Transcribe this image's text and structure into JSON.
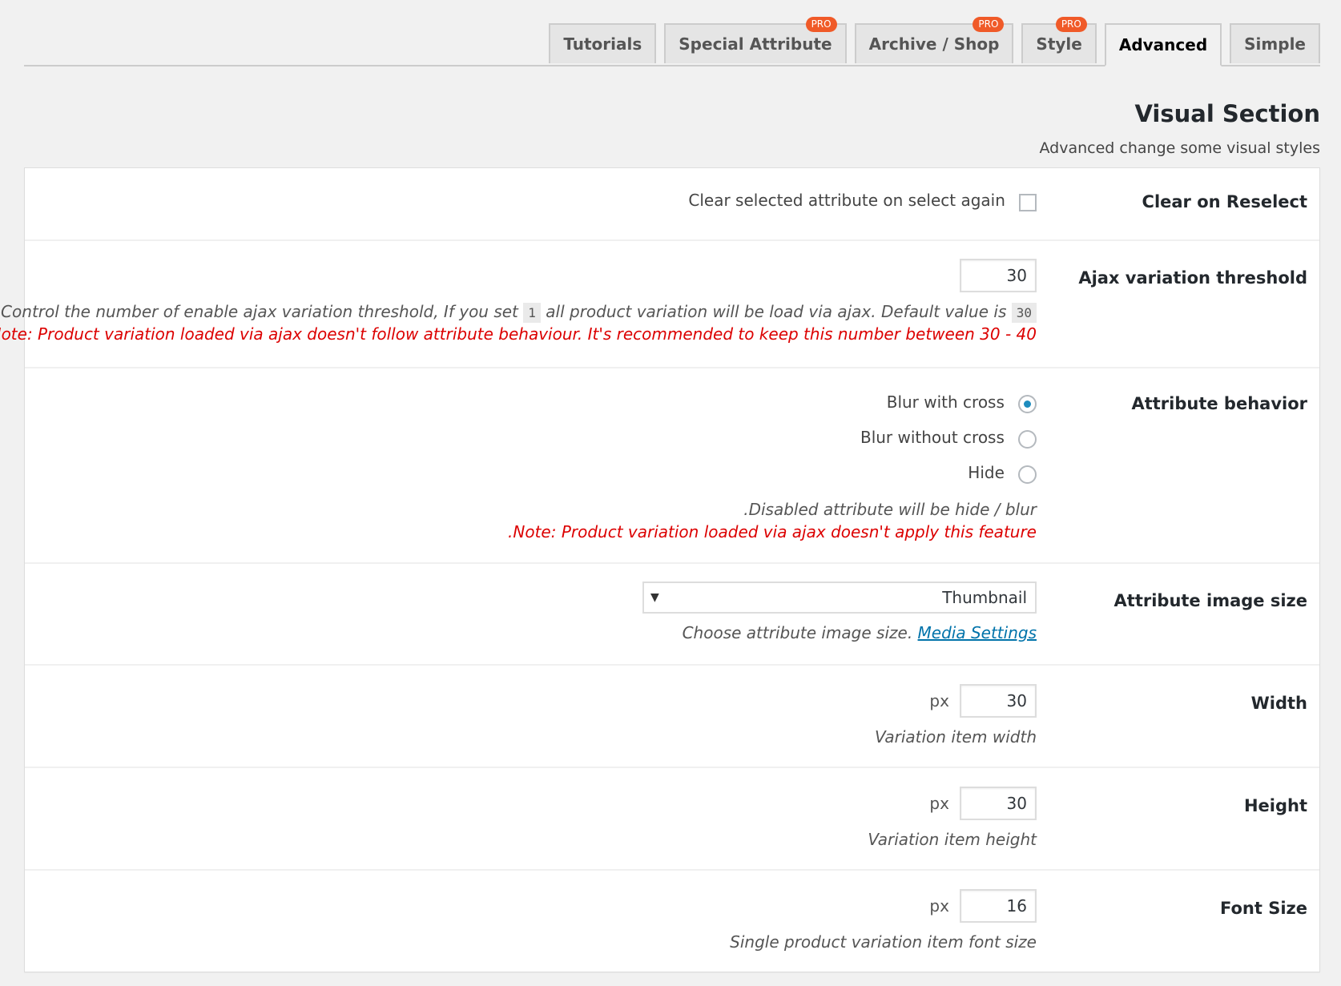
{
  "tabs": [
    {
      "label": "Tutorials",
      "pro": ""
    },
    {
      "label": "Special Attribute",
      "pro": "PRO"
    },
    {
      "label": "Archive / Shop",
      "pro": "PRO"
    },
    {
      "label": "Style",
      "pro": "PRO"
    },
    {
      "label": "Advanced",
      "pro": ""
    },
    {
      "label": "Simple",
      "pro": ""
    }
  ],
  "active_tab": "Advanced",
  "section": {
    "title": "Visual Section",
    "description": "Advanced change some visual styles"
  },
  "settings": {
    "clear_on_reselect": {
      "label": "Clear on Reselect",
      "checkbox_label": "Clear selected attribute on select again",
      "checked": false
    },
    "ajax_threshold": {
      "label": "Ajax variation threshold",
      "value": "30",
      "desc_part1": ",Control the number of enable ajax variation threshold, If you set",
      "code1": "1",
      "desc_part2": "all product variation will be load via ajax. Default value is",
      "code2": "30",
      "note": ".Note: Product variation loaded via ajax doesn't follow attribute behaviour. It's recommended to keep this number between 30 - 40"
    },
    "attribute_behavior": {
      "label": "Attribute behavior",
      "options": [
        "Blur with cross",
        "Blur without cross",
        "Hide"
      ],
      "selected": "Blur with cross",
      "desc": ".Disabled attribute will be hide / blur",
      "note": ".Note: Product variation loaded via ajax doesn't apply this feature"
    },
    "image_size": {
      "label": "Attribute image size",
      "value": "Thumbnail",
      "desc": "Choose attribute image size.",
      "link": "Media Settings"
    },
    "width": {
      "label": "Width",
      "unit": "px",
      "value": "30",
      "desc": "Variation item width"
    },
    "height": {
      "label": "Height",
      "unit": "px",
      "value": "30",
      "desc": "Variation item height"
    },
    "font_size": {
      "label": "Font Size",
      "unit": "px",
      "value": "16",
      "desc": "Single product variation item font size"
    }
  },
  "colors": {
    "pro_badge": "#f05a28",
    "note_red": "#dc0000",
    "link_blue": "#0073aa",
    "radio_selected": "#1e8cbe"
  }
}
